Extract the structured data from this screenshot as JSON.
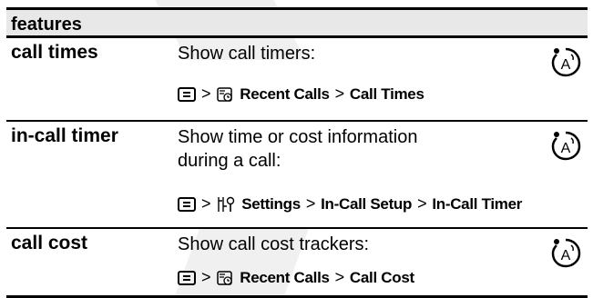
{
  "header": {
    "label": "features"
  },
  "rows": [
    {
      "name": "call times",
      "description": "Show call timers:",
      "path": {
        "app": "Recent Calls",
        "item": "Call Times"
      },
      "icon": "network-dependent-feature-icon"
    },
    {
      "name": "in-call timer",
      "description": "Show time or cost information during a call:",
      "path": {
        "app": "Settings",
        "item1": "In-Call Setup",
        "item2": "In-Call Timer"
      },
      "icon": "network-dependent-feature-icon"
    },
    {
      "name": "call cost",
      "description": "Show call cost trackers:",
      "path": {
        "app": "Recent Calls",
        "item": "Call Cost"
      },
      "icon": "network-dependent-feature-icon"
    }
  ],
  "separator": ">"
}
